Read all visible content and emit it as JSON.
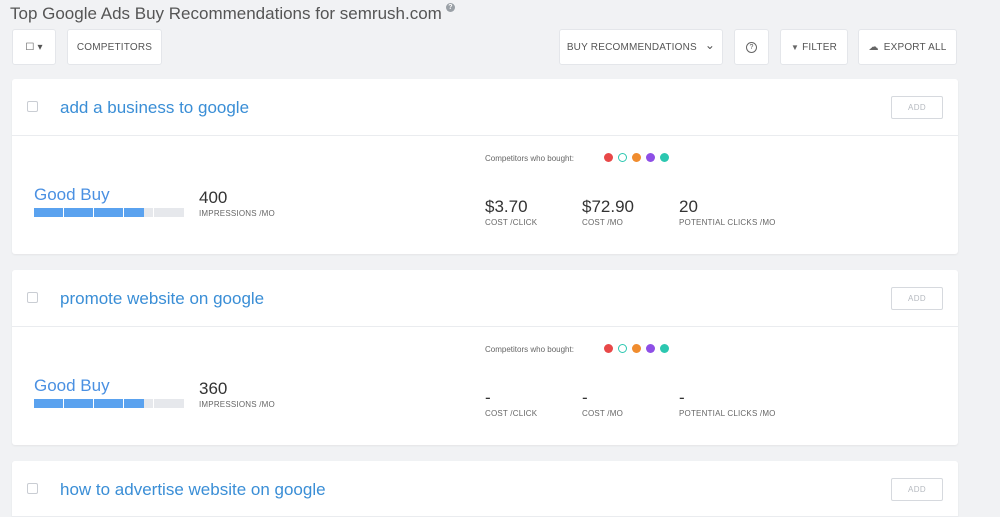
{
  "header": {
    "title": "Top Google Ads Buy Recommendations for semrush.com",
    "help_icon": "question-circle-icon",
    "help_glyph": "?"
  },
  "toolbar": {
    "select_glyph": "☐ ▾",
    "competitors_label": "COMPETITORS",
    "buy_recommendations_label": "BUY RECOMMENDATIONS",
    "dropdown_glyph": "⌄",
    "help_glyph": "?",
    "filter_label": "FILTER",
    "filter_glyph": "▼",
    "export_label": "EXPORT ALL",
    "export_glyph": "☁"
  },
  "colors": {
    "accent": "#3a8ed6",
    "bar_fill": "#5aa2ef",
    "competitor_dots": [
      "#e84848",
      "#2cc7b0",
      "#f08c2e",
      "#8e4fe6",
      "#2cc7b0"
    ]
  },
  "cards": [
    {
      "keyword": "add a business to google",
      "add_label": "ADD",
      "competitors_label": "Competitors who bought:",
      "buy_rating": "Good Buy",
      "rating_level": 0.73,
      "impressions": {
        "value": "400",
        "label": "IMPRESSIONS /MO"
      },
      "cost_click": {
        "value": "$3.70",
        "label": "COST /CLICK"
      },
      "cost_mo": {
        "value": "$72.90",
        "label": "COST /MO"
      },
      "potential_clicks": {
        "value": "20",
        "label": "POTENTIAL CLICKS /MO"
      }
    },
    {
      "keyword": "promote website on google",
      "add_label": "ADD",
      "competitors_label": "Competitors who bought:",
      "buy_rating": "Good Buy",
      "rating_level": 0.73,
      "impressions": {
        "value": "360",
        "label": "IMPRESSIONS /MO"
      },
      "cost_click": {
        "value": "-",
        "label": "COST /CLICK"
      },
      "cost_mo": {
        "value": "-",
        "label": "COST /MO"
      },
      "potential_clicks": {
        "value": "-",
        "label": "POTENTIAL CLICKS /MO"
      }
    },
    {
      "keyword": "how to advertise website on google",
      "add_label": "ADD"
    }
  ]
}
